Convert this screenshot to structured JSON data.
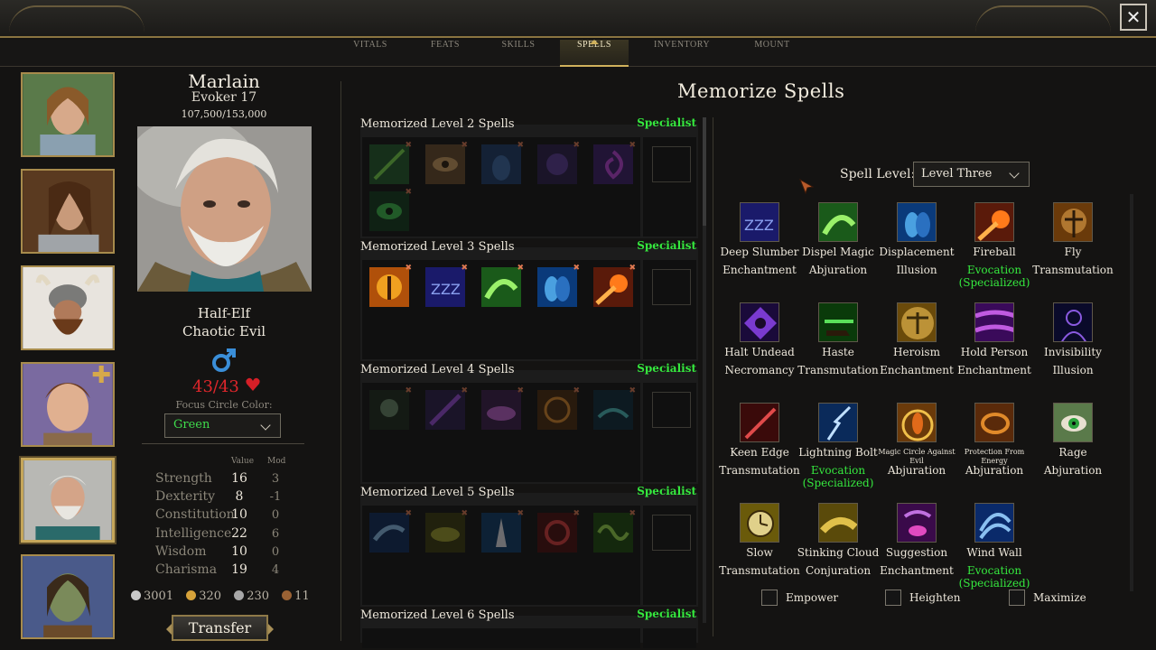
{
  "tabs": [
    "VITALS",
    "FEATS",
    "SKILLS",
    "SPELLS",
    "INVENTORY",
    "MOUNT"
  ],
  "active_tab": "SPELLS",
  "close_label": "✕",
  "character": {
    "name": "Marlain",
    "class": "Evoker 17",
    "xp": "107,500/153,000",
    "race": "Half-Elf",
    "alignment": "Chaotic Evil",
    "hp": "43/43",
    "focus_label": "Focus Circle Color:",
    "focus_color": "Green",
    "stat_headers": {
      "value": "Value",
      "mod": "Mod"
    },
    "stats": [
      {
        "name": "Strength",
        "value": "16",
        "mod": "3"
      },
      {
        "name": "Dexterity",
        "value": "8",
        "mod": "-1"
      },
      {
        "name": "Constitution",
        "value": "10",
        "mod": "0"
      },
      {
        "name": "Intelligence",
        "value": "22",
        "mod": "6"
      },
      {
        "name": "Wisdom",
        "value": "10",
        "mod": "0"
      },
      {
        "name": "Charisma",
        "value": "19",
        "mod": "4"
      }
    ],
    "coins": [
      {
        "amount": "3001",
        "color": "#c9c9c9"
      },
      {
        "amount": "320",
        "color": "#d6a23a"
      },
      {
        "amount": "230",
        "color": "#a8a8a8"
      },
      {
        "amount": "11",
        "color": "#9a6234"
      }
    ],
    "transfer_label": "Transfer"
  },
  "memorize": {
    "title": "Memorize Spells",
    "specialist_label": "Specialist",
    "blocks": [
      {
        "label": "Memorized Level 2 Spells",
        "slots": 6
      },
      {
        "label": "Memorized Level 3 Spells",
        "slots": 5
      },
      {
        "label": "Memorized Level 4 Spells",
        "slots": 5
      },
      {
        "label": "Memorized Level 5 Spells",
        "slots": 5
      },
      {
        "label": "Memorized Level 6 Spells",
        "slots": 5
      }
    ]
  },
  "spell_level": {
    "label": "Spell Level:",
    "value": "Level Three"
  },
  "spells": [
    {
      "name": "Deep Slumber",
      "school": "Enchantment",
      "specialized": false,
      "icon": "slumber-icon"
    },
    {
      "name": "Dispel Magic",
      "school": "Abjuration",
      "specialized": false,
      "icon": "dispel-icon"
    },
    {
      "name": "Displacement",
      "school": "Illusion",
      "specialized": false,
      "icon": "displacement-icon"
    },
    {
      "name": "Fireball",
      "school": "Evocation",
      "specialized": true,
      "icon": "fireball-icon"
    },
    {
      "name": "Fly",
      "school": "Transmutation",
      "specialized": false,
      "icon": "fly-icon"
    },
    {
      "name": "Halt Undead",
      "school": "Necromancy",
      "specialized": false,
      "icon": "halt-undead-icon"
    },
    {
      "name": "Haste",
      "school": "Transmutation",
      "specialized": false,
      "icon": "haste-icon"
    },
    {
      "name": "Heroism",
      "school": "Enchantment",
      "specialized": false,
      "icon": "heroism-icon"
    },
    {
      "name": "Hold Person",
      "school": "Enchantment",
      "specialized": false,
      "icon": "hold-person-icon"
    },
    {
      "name": "Invisibility",
      "school": "Illusion",
      "specialized": false,
      "icon": "invisibility-icon"
    },
    {
      "name": "Keen Edge",
      "school": "Transmutation",
      "specialized": false,
      "icon": "keen-edge-icon"
    },
    {
      "name": "Lightning Bolt",
      "school": "Evocation",
      "specialized": true,
      "icon": "lightning-icon"
    },
    {
      "name": "Magic Circle Against Evil",
      "school": "Abjuration",
      "specialized": false,
      "icon": "magic-circle-icon"
    },
    {
      "name": "Protection From Energy",
      "school": "Abjuration",
      "specialized": false,
      "icon": "protection-icon"
    },
    {
      "name": "Rage",
      "school": "Abjuration",
      "specialized": false,
      "icon": "rage-icon"
    },
    {
      "name": "Slow",
      "school": "Transmutation",
      "specialized": false,
      "icon": "slow-icon"
    },
    {
      "name": "Stinking Cloud",
      "school": "Conjuration",
      "specialized": false,
      "icon": "stinking-cloud-icon"
    },
    {
      "name": "Suggestion",
      "school": "Enchantment",
      "specialized": false,
      "icon": "suggestion-icon"
    },
    {
      "name": "Wind Wall",
      "school": "Evocation",
      "specialized": true,
      "icon": "wind-wall-icon"
    }
  ],
  "specialized_label": "(Specialized)",
  "metamagic": [
    "Empower",
    "Heighten",
    "Maximize"
  ]
}
